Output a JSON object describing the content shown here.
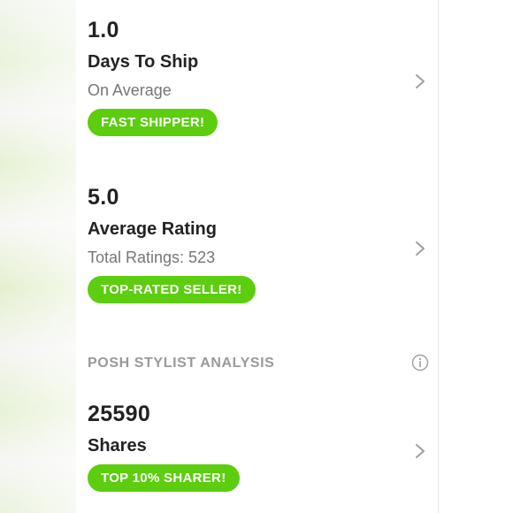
{
  "stats": [
    {
      "value": "1.0",
      "label": "Days To Ship",
      "sub": "On Average",
      "badge": "FAST SHIPPER!"
    },
    {
      "value": "5.0",
      "label": "Average Rating",
      "sub": "Total Ratings: 523",
      "badge": "TOP-RATED SELLER!"
    }
  ],
  "analysis": {
    "title": "POSH STYLIST ANALYSIS",
    "info_icon": "info-icon",
    "shares": {
      "value": "25590",
      "label": "Shares",
      "badge": "TOP 10% SHARER!"
    }
  },
  "colors": {
    "badge_green": "#5ccd0f",
    "text_dark": "#222222",
    "text_muted": "#767676",
    "section_gray": "#9a9a9a"
  },
  "icons": {
    "chevron": "chevron-right-icon",
    "info": "info-icon"
  }
}
